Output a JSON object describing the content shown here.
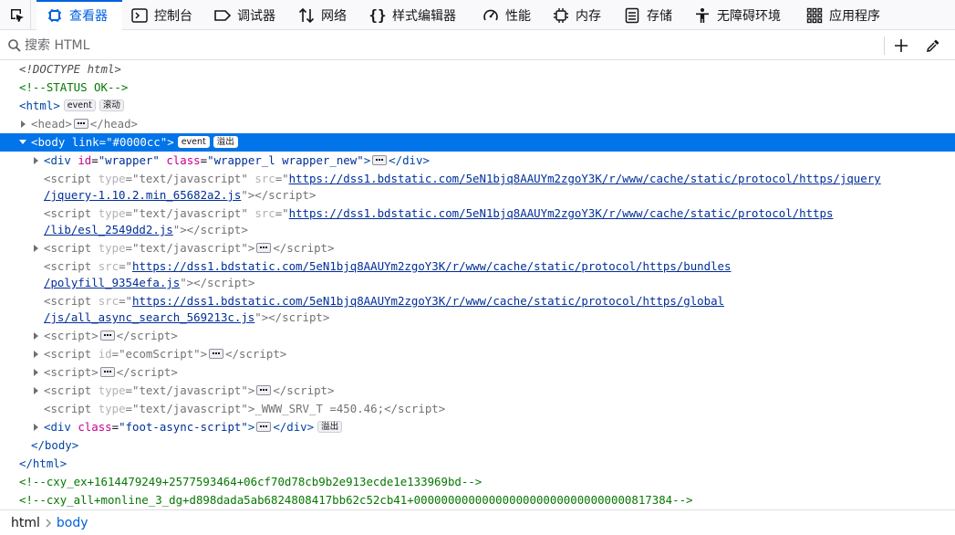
{
  "toolbar": {
    "tabs": [
      {
        "label": "查看器",
        "icon": "inspector-icon",
        "active": true
      },
      {
        "label": "控制台",
        "icon": "console-icon"
      },
      {
        "label": "调试器",
        "icon": "debugger-icon"
      },
      {
        "label": "网络",
        "icon": "network-icon"
      },
      {
        "label": "样式编辑器",
        "icon": "style-editor-icon"
      },
      {
        "label": "性能",
        "icon": "performance-icon"
      },
      {
        "label": "内存",
        "icon": "memory-icon"
      },
      {
        "label": "存储",
        "icon": "storage-icon"
      },
      {
        "label": "无障碍环境",
        "icon": "accessibility-icon"
      },
      {
        "label": "应用程序",
        "icon": "application-icon"
      }
    ],
    "accent_color": "#0061e0"
  },
  "search": {
    "placeholder": "搜索 HTML"
  },
  "markup": {
    "doctype": "<!DOCTYPE html>",
    "status_comment": "<!--STATUS OK-->",
    "html_tag": "html",
    "badge_event": "event",
    "badge_scroll": "滚动",
    "badge_overflow": "溢出",
    "head_tag": "head",
    "body_tag": "body",
    "body_attr": "link",
    "body_link": "\"#0000cc\"",
    "div_tag": "div",
    "script_tag": "script",
    "attr_id": "id",
    "attr_class": "class",
    "attr_type": "type",
    "attr_src": "src",
    "wrapper_id": "\"wrapper\"",
    "wrapper_class": "\"wrapper_l wrapper_new\"",
    "type_js": "\"text/javascript\"",
    "jquery_url_1": "https://dss1.bdstatic.com/5eN1bjq8AAUYm2zgoY3K/r/www/cache/static/protocol/https/jquery",
    "jquery_url_2": "/jquery-1.10.2.min_65682a2.js",
    "esl_url_1": "https://dss1.bdstatic.com/5eN1bjq8AAUYm2zgoY3K/r/www/cache/static/protocol/https",
    "esl_url_2": "/lib/esl_2549dd2.js",
    "polyfill_url_1": "https://dss1.bdstatic.com/5eN1bjq8AAUYm2zgoY3K/r/www/cache/static/protocol/https/bundles",
    "polyfill_url_2": "/polyfill_9354efa.js",
    "global_url_1": "https://dss1.bdstatic.com/5eN1bjq8AAUYm2zgoY3K/r/www/cache/static/protocol/https/global",
    "global_url_2": "/js/all_async_search_569213c.js",
    "ecom_id": "\"ecomScript\"",
    "srv_text": "_WWW_SRV_T =450.46;",
    "foot_class": "\"foot-async-script\"",
    "comment_ex": "<!--cxy_ex+1614479249+2577593464+06cf70d78cb9b2e913ecde1e133969bd-->",
    "comment_all": "<!--cxy_all+monline_3_dg+d898dada5ab6824808417bb62c52cb41+00000000000000000000000000000000817384-->"
  },
  "breadcrumbs": [
    {
      "label": "html"
    },
    {
      "label": "body",
      "current": true
    }
  ]
}
